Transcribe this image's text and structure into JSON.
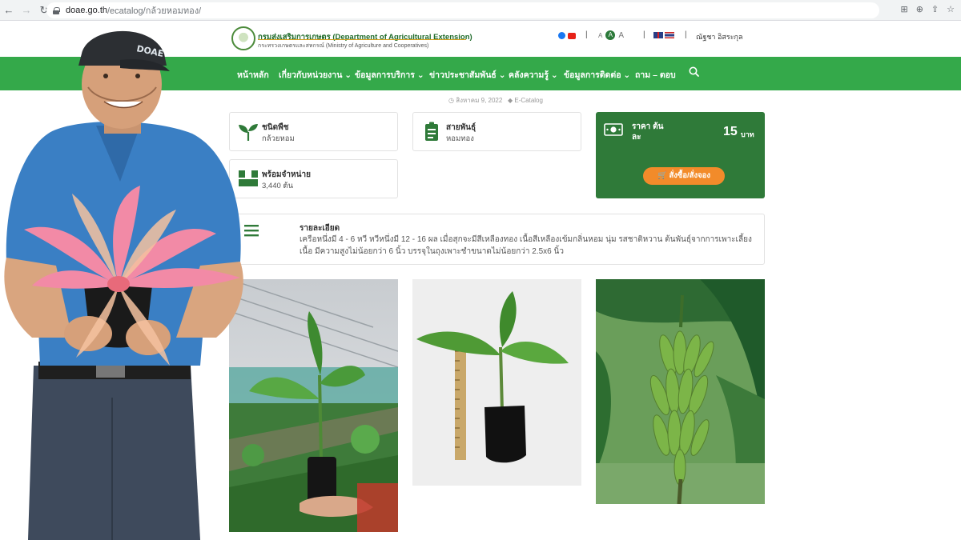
{
  "browser": {
    "url_host": "doae.go.th",
    "url_path": "/ecatalog/กล้วยหอมทอง/"
  },
  "site": {
    "org_name": "กรมส่งเสริมการเกษตร (Department of Agricultural Extension)",
    "org_sub": "กระทรวงเกษตรและสหกรณ์ (Ministry of Agriculture and Cooperatives)",
    "font_sizes": [
      "A",
      "A",
      "A"
    ],
    "user_name": "ณัฐชา อิสระกุล",
    "cap_text": "DOAE"
  },
  "nav": {
    "items": [
      {
        "label": "หน้าหลัก"
      },
      {
        "label": "เกี่ยวกับหน่วยงาน ⌄"
      },
      {
        "label": "ข้อมูลการบริการ ⌄"
      },
      {
        "label": "ข่าวประชาสัมพันธ์ ⌄"
      },
      {
        "label": "คลังความรู้ ⌄"
      },
      {
        "label": "ข้อมูลการติดต่อ ⌄"
      },
      {
        "label": "ถาม – ตอบ"
      }
    ]
  },
  "meta": {
    "date": "สิงหาคม 9, 2022",
    "category": "E-Catalog"
  },
  "cards": {
    "plant_type": {
      "title": "ชนิดพืช",
      "value": "กล้วยหอม"
    },
    "variety": {
      "title": "สายพันธุ์",
      "value": "หอมทอง"
    },
    "available": {
      "title": "พร้อมจำหน่าย",
      "value": "3,440 ต้น"
    },
    "price": {
      "title": "ราคา ต้นละ",
      "amount": "15",
      "unit": "บาท",
      "button": "สั่งซื้อ/สั่งจอง"
    }
  },
  "details": {
    "title": "รายละเอียด",
    "text": "เครือหนึ่งมี 4 - 6 หวี หวีหนึ่งมี 12 - 16 ผล เมื่อสุกจะมีสีเหลืองทอง เนื้อสีเหลืองเข้มกลิ่นหอม นุ่ม รสชาติหวาน ต้นพันธุ์จากการเพาะเลี้ยงเนื้อ มีความสูงไม่น้อยกว่า 6 นิ้ว บรรจุในถุงเพาะชำขนาดไม่น้อยกว่า 2.5x6 นิ้ว"
  },
  "colors": {
    "nav_green": "#34a94a",
    "price_green": "#2f7a39",
    "order_orange": "#f28b2a"
  }
}
